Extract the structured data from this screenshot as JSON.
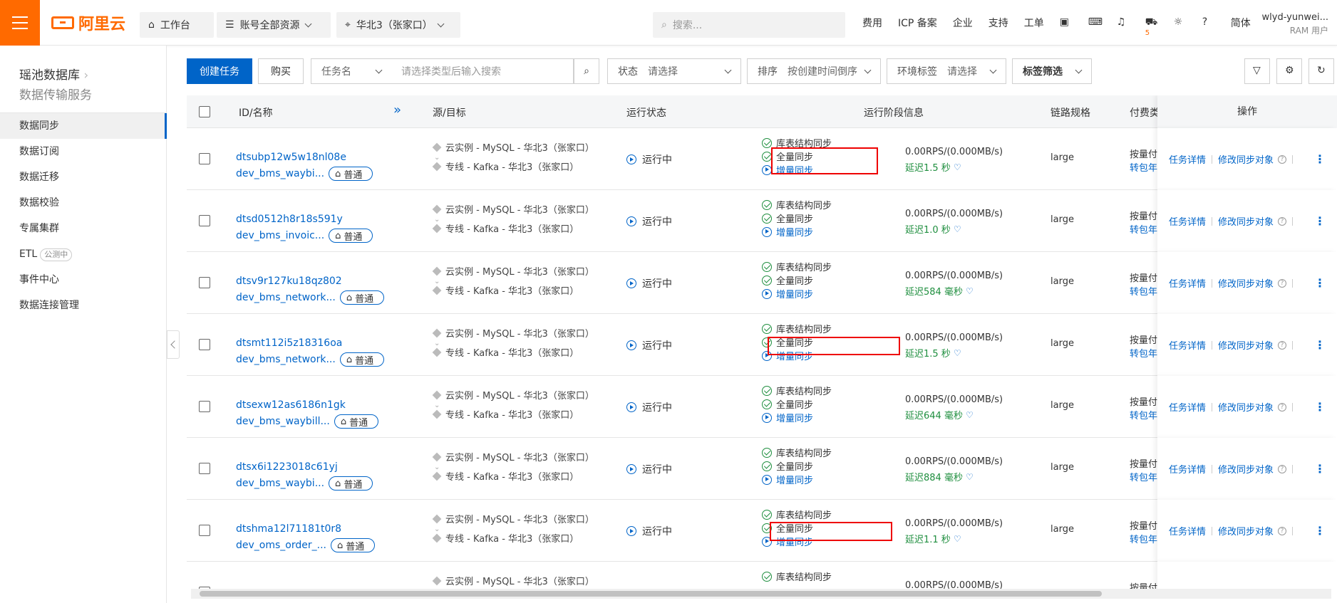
{
  "topbar": {
    "brand": "阿里云",
    "workbench": "工作台",
    "resources": "账号全部资源",
    "region": "华北3（张家口）",
    "search_placeholder": "搜索...",
    "links": [
      "费用",
      "ICP 备案",
      "企业",
      "支持",
      "工单"
    ],
    "cart_badge": "5",
    "lang": "简体",
    "username": "wlyd-yunwei...",
    "user_role": "RAM 用户"
  },
  "sidebar": {
    "title": "瑶池数据库",
    "subtitle": "数据传输服务",
    "items": [
      {
        "label": "数据同步",
        "badge": ""
      },
      {
        "label": "数据订阅",
        "badge": ""
      },
      {
        "label": "数据迁移",
        "badge": ""
      },
      {
        "label": "数据校验",
        "badge": ""
      },
      {
        "label": "专属集群",
        "badge": ""
      },
      {
        "label": "ETL",
        "badge": "公测中"
      },
      {
        "label": "事件中心",
        "badge": ""
      },
      {
        "label": "数据连接管理",
        "badge": ""
      }
    ]
  },
  "toolbar": {
    "create": "创建任务",
    "buy": "购买",
    "search_field": "任务名",
    "search_placeholder": "请选择类型后输入搜索",
    "status_label": "状态",
    "status_value": "请选择",
    "sort_label": "排序",
    "sort_value": "按创建时间倒序",
    "env_label": "环境标签",
    "env_value": "请选择",
    "tag_filter": "标签筛选"
  },
  "table": {
    "headers": {
      "id": "ID/名称",
      "src": "源/目标",
      "status": "运行状态",
      "stage": "运行阶段信息",
      "spec": "链路规格",
      "pay": "付费类",
      "ops": "操作"
    },
    "rows": [
      {
        "id": "dtsubp12w5w18nl08e",
        "name": "dev_bms_waybi...",
        "tag": "普通",
        "source": "云实例 - MySQL - 华北3（张家口）",
        "target": "专线 - Kafka - 华北3（张家口）",
        "status": "运行中",
        "stage1": "库表结构同步",
        "stage2": "全量同步",
        "stage3": "增量同步",
        "rps": "0.00RPS/(0.000MB/s)",
        "delay": "延迟1.5 秒",
        "spec": "large",
        "pay1": "按量付",
        "pay2": "转包年",
        "op1": "任务详情",
        "op2": "修改同步对象"
      },
      {
        "id": "dtsd0512h8r18s591y",
        "name": "dev_bms_invoic...",
        "tag": "普通",
        "source": "云实例 - MySQL - 华北3（张家口）",
        "target": "专线 - Kafka - 华北3（张家口）",
        "status": "运行中",
        "stage1": "库表结构同步",
        "stage2": "全量同步",
        "stage3": "增量同步",
        "rps": "0.00RPS/(0.000MB/s)",
        "delay": "延迟1.0 秒",
        "spec": "large",
        "pay1": "按量付",
        "pay2": "转包年",
        "op1": "任务详情",
        "op2": "修改同步对象"
      },
      {
        "id": "dtsv9r127ku18qz802",
        "name": "dev_bms_network...",
        "tag": "普通",
        "source": "云实例 - MySQL - 华北3（张家口）",
        "target": "专线 - Kafka - 华北3（张家口）",
        "status": "运行中",
        "stage1": "库表结构同步",
        "stage2": "全量同步",
        "stage3": "增量同步",
        "rps": "0.00RPS/(0.000MB/s)",
        "delay": "延迟584 毫秒",
        "spec": "large",
        "pay1": "按量付",
        "pay2": "转包年",
        "op1": "任务详情",
        "op2": "修改同步对象"
      },
      {
        "id": "dtsmt112i5z18316oa",
        "name": "dev_bms_network...",
        "tag": "普通",
        "source": "云实例 - MySQL - 华北3（张家口）",
        "target": "专线 - Kafka - 华北3（张家口）",
        "status": "运行中",
        "stage1": "库表结构同步",
        "stage2": "全量同步",
        "stage3": "增量同步",
        "rps": "0.00RPS/(0.000MB/s)",
        "delay": "延迟1.5 秒",
        "spec": "large",
        "pay1": "按量付",
        "pay2": "转包年",
        "op1": "任务详情",
        "op2": "修改同步对象"
      },
      {
        "id": "dtsexw12as6186n1gk",
        "name": "dev_bms_waybill...",
        "tag": "普通",
        "source": "云实例 - MySQL - 华北3（张家口）",
        "target": "专线 - Kafka - 华北3（张家口）",
        "status": "运行中",
        "stage1": "库表结构同步",
        "stage2": "全量同步",
        "stage3": "增量同步",
        "rps": "0.00RPS/(0.000MB/s)",
        "delay": "延迟644 毫秒",
        "spec": "large",
        "pay1": "按量付",
        "pay2": "转包年",
        "op1": "任务详情",
        "op2": "修改同步对象"
      },
      {
        "id": "dtsx6i1223018c61yj",
        "name": "dev_bms_waybi...",
        "tag": "普通",
        "source": "云实例 - MySQL - 华北3（张家口）",
        "target": "专线 - Kafka - 华北3（张家口）",
        "status": "运行中",
        "stage1": "库表结构同步",
        "stage2": "全量同步",
        "stage3": "增量同步",
        "rps": "0.00RPS/(0.000MB/s)",
        "delay": "延迟884 毫秒",
        "spec": "large",
        "pay1": "按量付",
        "pay2": "转包年",
        "op1": "任务详情",
        "op2": "修改同步对象"
      },
      {
        "id": "dtshma12l71181t0r8",
        "name": "dev_oms_order_...",
        "tag": "普通",
        "source": "云实例 - MySQL - 华北3（张家口）",
        "target": "专线 - Kafka - 华北3（张家口）",
        "status": "运行中",
        "stage1": "库表结构同步",
        "stage2": "全量同步",
        "stage3": "增量同步",
        "rps": "0.00RPS/(0.000MB/s)",
        "delay": "延迟1.1 秒",
        "spec": "large",
        "pay1": "按量付",
        "pay2": "转包年",
        "op1": "任务详情",
        "op2": "修改同步对象"
      },
      {
        "id": "",
        "name": "",
        "tag": "",
        "source": "云实例 - MySQL - 华北3（张家口）",
        "target": "",
        "status": "",
        "stage1": "库表结构同步",
        "stage2": "",
        "stage3": "",
        "rps": "0.00RPS/(0.000MB/s)",
        "delay": "",
        "spec": "",
        "pay1": "按量付",
        "pay2": "",
        "op1": "",
        "op2": ""
      }
    ]
  },
  "colors": {
    "brand": "#ff6a00",
    "primary": "#0064c8",
    "success": "#1e8e3e",
    "highlight": "#e00000"
  }
}
